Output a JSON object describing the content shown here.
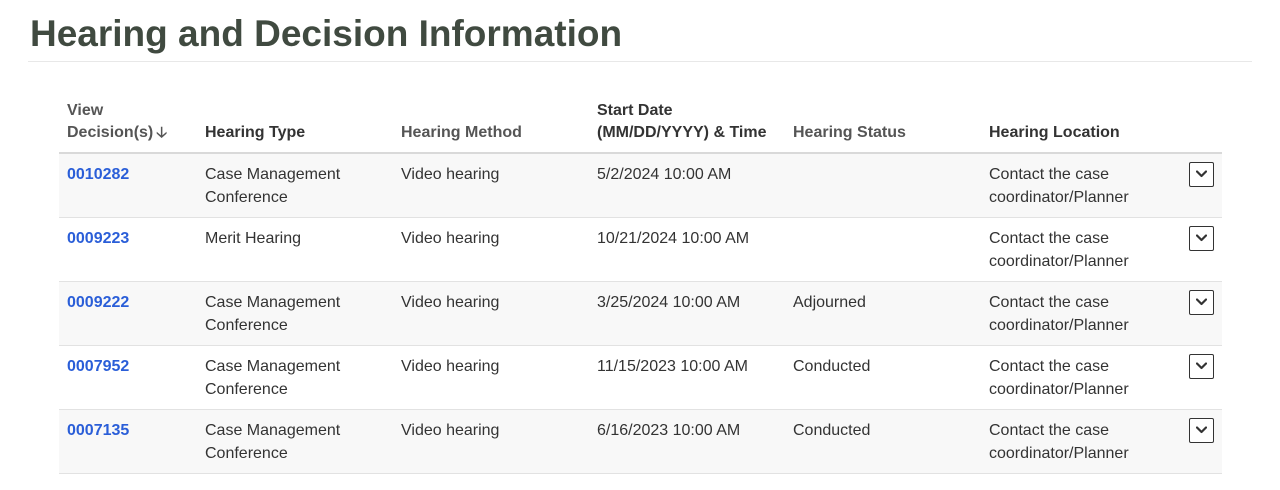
{
  "page": {
    "title": "Hearing and Decision Information"
  },
  "table": {
    "headers": {
      "view_decision_line1": "View",
      "view_decision_line2": "Decision(s)",
      "sort_arrow": "🡣",
      "hearing_type": "Hearing Type",
      "hearing_method": "Hearing Method",
      "start_date_line1": "Start Date",
      "start_date_line2": "(MM/DD/YYYY) & Time",
      "hearing_status": "Hearing Status",
      "hearing_location": "Hearing Location"
    },
    "rows": [
      {
        "decision": "0010282",
        "type_l1": "Case Management",
        "type_l2": "Conference",
        "method": "Video hearing",
        "start": "5/2/2024 10:00 AM",
        "status": "",
        "loc_l1": "Contact the case",
        "loc_l2": "coordinator/Planner"
      },
      {
        "decision": "0009223",
        "type_l1": "Merit Hearing",
        "type_l2": "",
        "method": "Video hearing",
        "start": "10/21/2024 10:00 AM",
        "status": "",
        "loc_l1": "Contact the case",
        "loc_l2": "coordinator/Planner"
      },
      {
        "decision": "0009222",
        "type_l1": "Case Management",
        "type_l2": "Conference",
        "method": "Video hearing",
        "start": "3/25/2024 10:00 AM",
        "status": "Adjourned",
        "loc_l1": "Contact the case",
        "loc_l2": "coordinator/Planner"
      },
      {
        "decision": "0007952",
        "type_l1": "Case Management",
        "type_l2": "Conference",
        "method": "Video hearing",
        "start": "11/15/2023 10:00 AM",
        "status": "Conducted",
        "loc_l1": "Contact the case",
        "loc_l2": "coordinator/Planner"
      },
      {
        "decision": "0007135",
        "type_l1": "Case Management",
        "type_l2": "Conference",
        "method": "Video hearing",
        "start": "6/16/2023 10:00 AM",
        "status": "Conducted",
        "loc_l1": "Contact the case",
        "loc_l2": "coordinator/Planner"
      }
    ]
  },
  "icons": {
    "expand": "chevron-down-icon",
    "sort": "sort-down-arrow-icon"
  },
  "colors": {
    "title": "#404a40",
    "link": "#2a5ed8",
    "row_alt": "#f8f8f8"
  }
}
